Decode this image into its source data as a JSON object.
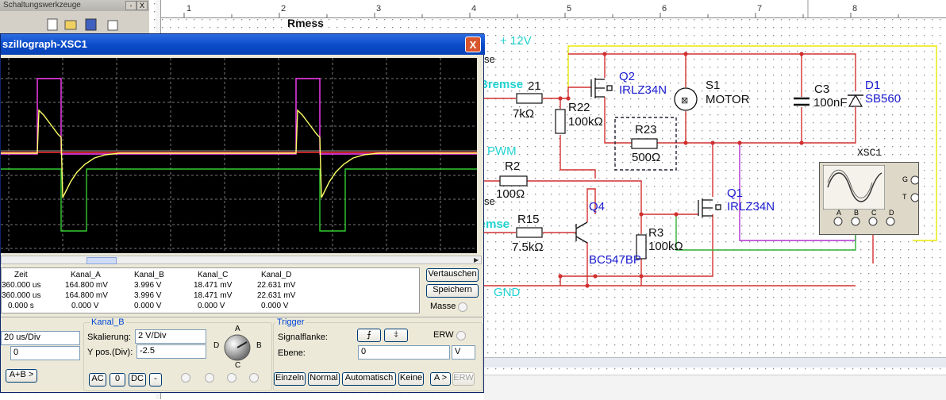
{
  "toolbar_window": {
    "title": "Schaltungswerkzeuge",
    "min_label": "-",
    "close_label": "X"
  },
  "ruler": {
    "numbers": [
      "1",
      "2",
      "3",
      "4",
      "5",
      "6",
      "7",
      "8"
    ]
  },
  "circuit": {
    "labels": {
      "rmess": "Rmess",
      "v12": "+ 12V",
      "se1": "se",
      "bremse1": "Bremse",
      "r21": "21",
      "r21v": "7kΩ",
      "q2": "Q2",
      "q2t": "IRLZ34N",
      "r22": "R22",
      "r22v": "100kΩ",
      "s1": "S1",
      "motor": "MOTOR",
      "c3": "C3",
      "c3v": "100nF",
      "d1": "D1",
      "d1t": "SB560",
      "r23": "R23",
      "r23v": "500Ω",
      "xsc1": "XSC1",
      "pwm": "PWM",
      "r2": "R2",
      "r2v": "100Ω",
      "se2": "se",
      "q1": "Q1",
      "q1t": "IRLZ34N",
      "q4": "Q4",
      "bremse2": "Bremse",
      "r15": "R15",
      "r15v": "7.5kΩ",
      "r3": "R3",
      "r3v": "100kΩ",
      "bc": "BC547BP",
      "gnd": "GND",
      "xg": "G",
      "xt": "T",
      "xa": "A",
      "xb": "B",
      "xc": "C",
      "xd": "D"
    }
  },
  "oscilloscope": {
    "title": "szillograph-XSC1",
    "close_label": "X",
    "colors": {
      "channel_a": "#ffff66",
      "channel_b": "#ff40ff",
      "channel_c": "#33cc33",
      "channel_d": "#ff3030"
    },
    "measurements": {
      "headers": [
        "Zeit",
        "Kanal_A",
        "Kanal_B",
        "Kanal_C",
        "Kanal_D"
      ],
      "rows": [
        [
          "360.000 us",
          "164.800 mV",
          "3.996 V",
          "18.471 mV",
          "22.631 mV"
        ],
        [
          "360.000 us",
          "164.800 mV",
          "3.996 V",
          "18.471 mV",
          "22.631 mV"
        ],
        [
          "0.000 s",
          "0.000 V",
          "0.000 V",
          "0.000 V",
          "0.000 V"
        ]
      ]
    },
    "buttons": {
      "vertauschen": "Vertauschen",
      "speichern": "Speichern",
      "masse": "Masse"
    },
    "timebase": {
      "scale_value": "20 us/Div",
      "xpos_value": "0",
      "mode_btn": "A+B >"
    },
    "kanal_b": {
      "title": "Kanal_B",
      "scale_label": "Skalierung:",
      "scale_value": "2  V/Div",
      "ypos_label": "Y pos.(Div):",
      "ypos_value": "-2.5",
      "ac": "AC",
      "zero": "0",
      "dc": "DC",
      "minus": "-",
      "knob_a": "A",
      "knob_b": "B",
      "knob_c": "C",
      "knob_d": "D"
    },
    "trigger": {
      "title": "Trigger",
      "flank_label": "Signalflanke:",
      "level_label": "Ebene:",
      "level_value": "0",
      "level_unit": "V",
      "erw": "ERW",
      "einzeln": "Einzeln",
      "normal": "Normal",
      "automatisch": "Automatisch",
      "keine": "Keine",
      "a_btn": "A >",
      "erw_btn": "ERW"
    }
  }
}
